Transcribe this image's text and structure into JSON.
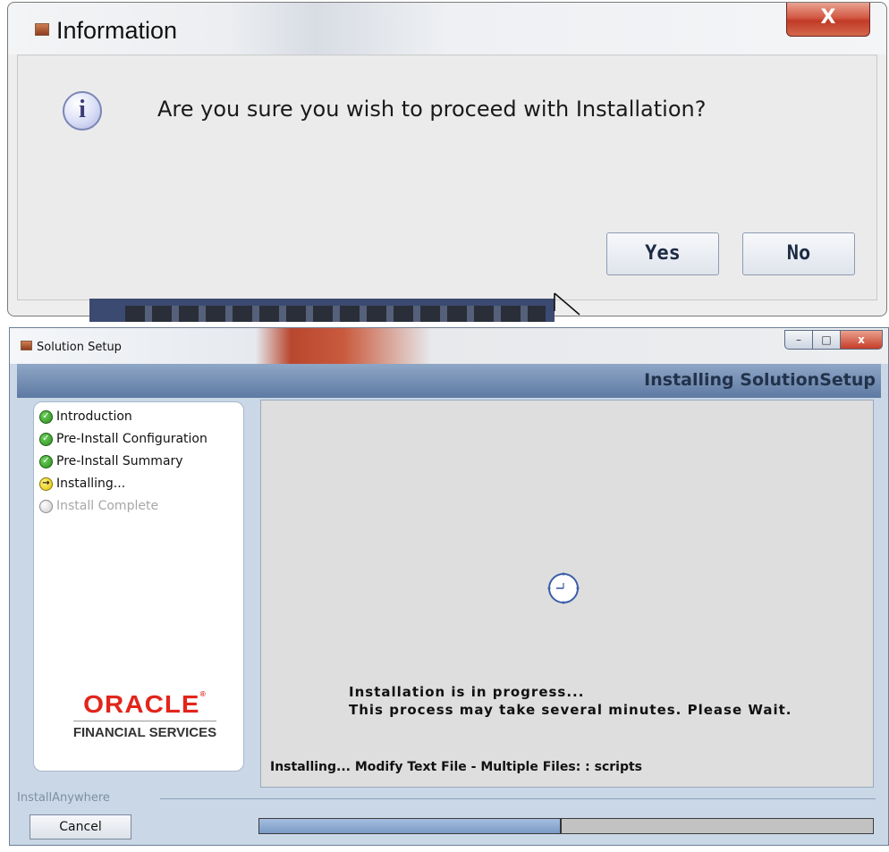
{
  "info_dialog": {
    "title": "Information",
    "close_label": "X",
    "message": "Are you sure you wish to proceed with Installation?",
    "info_icon_glyph": "i",
    "yes_label": "Yes",
    "no_label": "No"
  },
  "setup": {
    "window_title": "Solution Setup",
    "close_label": "x",
    "header_title": "Installing SolutionSetup",
    "steps": [
      {
        "label": "Introduction",
        "state": "done"
      },
      {
        "label": "Pre-Install Configuration",
        "state": "done"
      },
      {
        "label": "Pre-Install Summary",
        "state": "done"
      },
      {
        "label": "Installing...",
        "state": "current"
      },
      {
        "label": "Install Complete",
        "state": "pending"
      }
    ],
    "brand_word": "ORACLE",
    "brand_trademark": "®",
    "brand_subtitle": "FINANCIAL SERVICES",
    "progress_title": "Installation is in progress...",
    "progress_subtitle": "This process may take several minutes. Please Wait.",
    "current_action": "Installing... Modify Text File - Multiple Files: : scripts",
    "footer_label": "InstallAnywhere",
    "cancel_label": "Cancel",
    "progress_fraction": 0.49
  },
  "colors": {
    "oracle_red": "#e2251b",
    "header_blue": "#6f88ae",
    "progress_fill": "#8aa7cf"
  },
  "icons": {
    "info": "info-circle-icon",
    "step_done": "green-check-icon",
    "step_current": "yellow-arrow-icon",
    "step_pending": "gray-circle-icon",
    "busy": "clock-icon"
  }
}
